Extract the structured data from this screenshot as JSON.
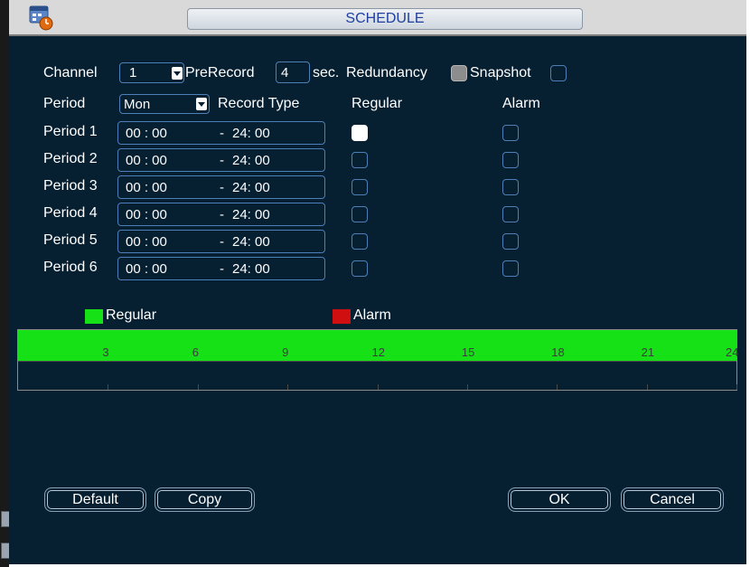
{
  "window": {
    "title": "SCHEDULE"
  },
  "channel": {
    "label": "Channel",
    "value": "1"
  },
  "prerecord": {
    "label": "PreRecord",
    "value": "4",
    "unit": "sec."
  },
  "redundancy": {
    "label": "Redundancy",
    "checked": false
  },
  "snapshot": {
    "label": "Snapshot",
    "checked": false
  },
  "period_row": {
    "label": "Period",
    "day": "Mon",
    "record_type_label": "Record Type",
    "regular_label": "Regular",
    "alarm_label": "Alarm"
  },
  "periods": [
    {
      "label": "Period 1",
      "start": "00 : 00",
      "end": "24:  00",
      "regular": true,
      "alarm": false
    },
    {
      "label": "Period 2",
      "start": "00 : 00",
      "end": "24:  00",
      "regular": false,
      "alarm": false
    },
    {
      "label": "Period 3",
      "start": "00 : 00",
      "end": "24:  00",
      "regular": false,
      "alarm": false
    },
    {
      "label": "Period 4",
      "start": "00 : 00",
      "end": "24:  00",
      "regular": false,
      "alarm": false
    },
    {
      "label": "Period 5",
      "start": "00 : 00",
      "end": "24:  00",
      "regular": false,
      "alarm": false
    },
    {
      "label": "Period 6",
      "start": "00 : 00",
      "end": "24:  00",
      "regular": false,
      "alarm": false
    }
  ],
  "legend": {
    "regular_label": "Regular",
    "regular_color": "#16e016",
    "alarm_label": "Alarm",
    "alarm_color": "#d01010"
  },
  "timeline": {
    "hour_labels": [
      "3",
      "6",
      "9",
      "12",
      "15",
      "18",
      "21",
      "24"
    ],
    "regular_coverage_hours": [
      0,
      24
    ]
  },
  "buttons": {
    "default": "Default",
    "copy": "Copy",
    "ok": "OK",
    "cancel": "Cancel"
  }
}
